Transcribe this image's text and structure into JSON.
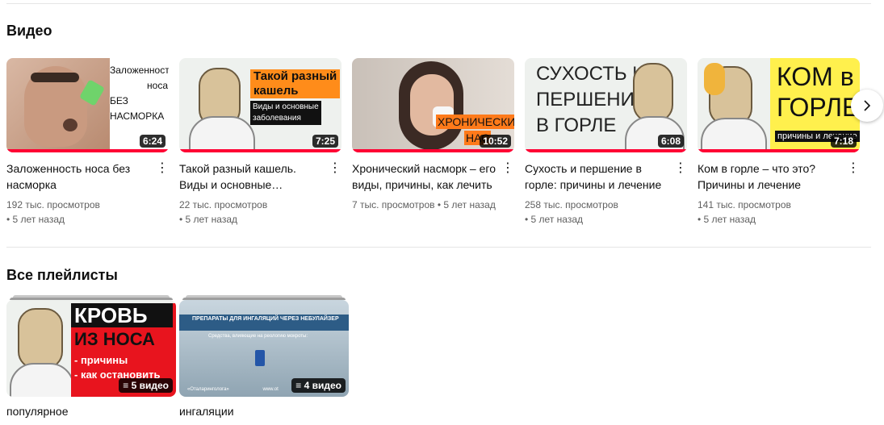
{
  "videos_section": {
    "title": "Видео"
  },
  "videos": [
    {
      "title": "Заложенность носа без насморка",
      "views": "192 тыс. просмотров",
      "age": "• 5 лет назад",
      "duration": "6:24",
      "thumb_text": [
        "Заложенность",
        "носа",
        "БЕЗ",
        "НАСМОРКА"
      ]
    },
    {
      "title": "Такой разный кашель. Виды и основные…",
      "views": "22 тыс. просмотров",
      "age": "• 5 лет назад",
      "duration": "7:25",
      "thumb_text": [
        "Такой разный",
        "кашель",
        "Виды и основные",
        "заболевания"
      ]
    },
    {
      "title": "Хронический насморк – его виды, причины, как лечить",
      "views": "7 тыс. просмотров • 5 лет назад",
      "age": "",
      "duration": "10:52",
      "thumb_text": [
        "ХРОНИЧЕСКИЙ",
        "НАС"
      ]
    },
    {
      "title": "Сухость и першение в горле: причины и лечение",
      "views": "258 тыс. просмотров",
      "age": "• 5 лет назад",
      "duration": "6:08",
      "thumb_text": [
        "СУХОСТЬ И",
        "ПЕРШЕНИЕ",
        "В ГОРЛЕ"
      ]
    },
    {
      "title": "Ком в горле – что это? Причины и лечение",
      "views": "141 тыс. просмотров",
      "age": "• 5 лет назад",
      "duration": "7:18",
      "thumb_text": [
        "КОМ в",
        "ГОРЛЕ",
        "причины и лечение"
      ]
    }
  ],
  "playlists_section": {
    "title": "Все плейлисты"
  },
  "playlists": [
    {
      "title": "популярное",
      "count": "5 видео",
      "thumb_text": [
        "КРОВЬ",
        "ИЗ НОСА",
        "- причины",
        "- как остановить"
      ]
    },
    {
      "title": "ингаляции",
      "count": "4 видео",
      "thumb_text": [
        "ПРЕПАРАТЫ ДЛЯ ИНГАЛЯЦИЙ ЧЕРЕЗ НЕБУЛАЙЗЕР",
        "Средства, влияющие на реологию мокроты:",
        "«Оталаринголога»",
        "www.ot"
      ]
    }
  ]
}
